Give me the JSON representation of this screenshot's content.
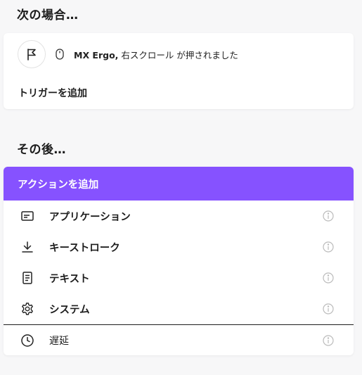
{
  "when": {
    "title": "次の場合…",
    "trigger": {
      "device": "MX Ergo,",
      "description": " 右スクロール が押されました"
    },
    "add_trigger_label": "トリガーを追加"
  },
  "then": {
    "title": "その後…",
    "add_action_label": "アクションを追加",
    "actions": [
      {
        "label": "アプリケーション",
        "icon": "application-icon"
      },
      {
        "label": "キーストローク",
        "icon": "download-arrow-icon"
      },
      {
        "label": "テキスト",
        "icon": "document-icon"
      },
      {
        "label": "システム",
        "icon": "gear-icon"
      },
      {
        "label": "遅延",
        "icon": "clock-icon"
      }
    ]
  },
  "colors": {
    "accent": "#8652ff",
    "background": "#f7f7f8",
    "card": "#ffffff"
  }
}
